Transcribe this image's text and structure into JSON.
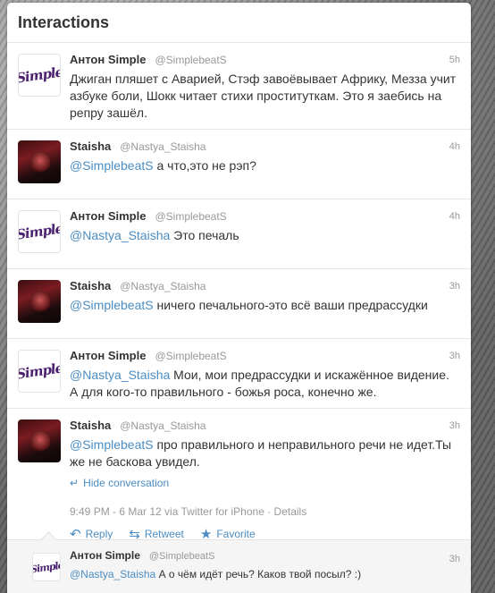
{
  "header": {
    "title": "Interactions"
  },
  "tweets": [
    {
      "name": "Антон Simple",
      "handle": "@SimplebeatS",
      "time": "5h",
      "mention": "",
      "text": "Джиган пляшет с Аварией, Стэф завоёвывает Африку, Мезза учит азбуке боли, Шокк читает стихи проституткам. Это я заебись на репру зашёл."
    },
    {
      "name": "Staisha",
      "handle": "@Nastya_Staisha",
      "time": "4h",
      "mention": "@SimplebeatS",
      "text": " а что,это не рэп?"
    },
    {
      "name": "Антон Simple",
      "handle": "@SimplebeatS",
      "time": "4h",
      "mention": "@Nastya_Staisha",
      "text": " Это печаль"
    },
    {
      "name": "Staisha",
      "handle": "@Nastya_Staisha",
      "time": "3h",
      "mention": "@SimplebeatS",
      "text": " ничего печального-это всё ваши предрассудки"
    },
    {
      "name": "Антон Simple",
      "handle": "@SimplebeatS",
      "time": "3h",
      "mention": "@Nastya_Staisha",
      "text": " Мои, мои предрассудки и искажённое видение. А для кого-то правильного - божья роса, конечно же."
    },
    {
      "name": "Staisha",
      "handle": "@Nastya_Staisha",
      "time": "3h",
      "mention": "@SimplebeatS",
      "text": " про правильного и неправильного речи не идет.Ты же не баскова увидел."
    }
  ],
  "expanded": {
    "hide_conversation": "Hide conversation",
    "details_line": "9:49 PM - 6 Mar 12 via Twitter for iPhone · Details",
    "reply_label": "Reply",
    "retweet_label": "Retweet",
    "favorite_label": "Favorite"
  },
  "reply": {
    "name": "Антон Simple",
    "handle": "@SimplebeatS",
    "time": "3h",
    "mention": "@Nastya_Staisha",
    "text": " А о чём идёт речь? Каков твой посыл? :)"
  },
  "avatars": {
    "simple_text": "Simple"
  },
  "colors": {
    "link": "#4b8dc2",
    "text": "#333333",
    "muted": "#999999"
  },
  "icons": [
    "reply-icon",
    "retweet-icon",
    "star-icon",
    "arrow-left-icon"
  ]
}
